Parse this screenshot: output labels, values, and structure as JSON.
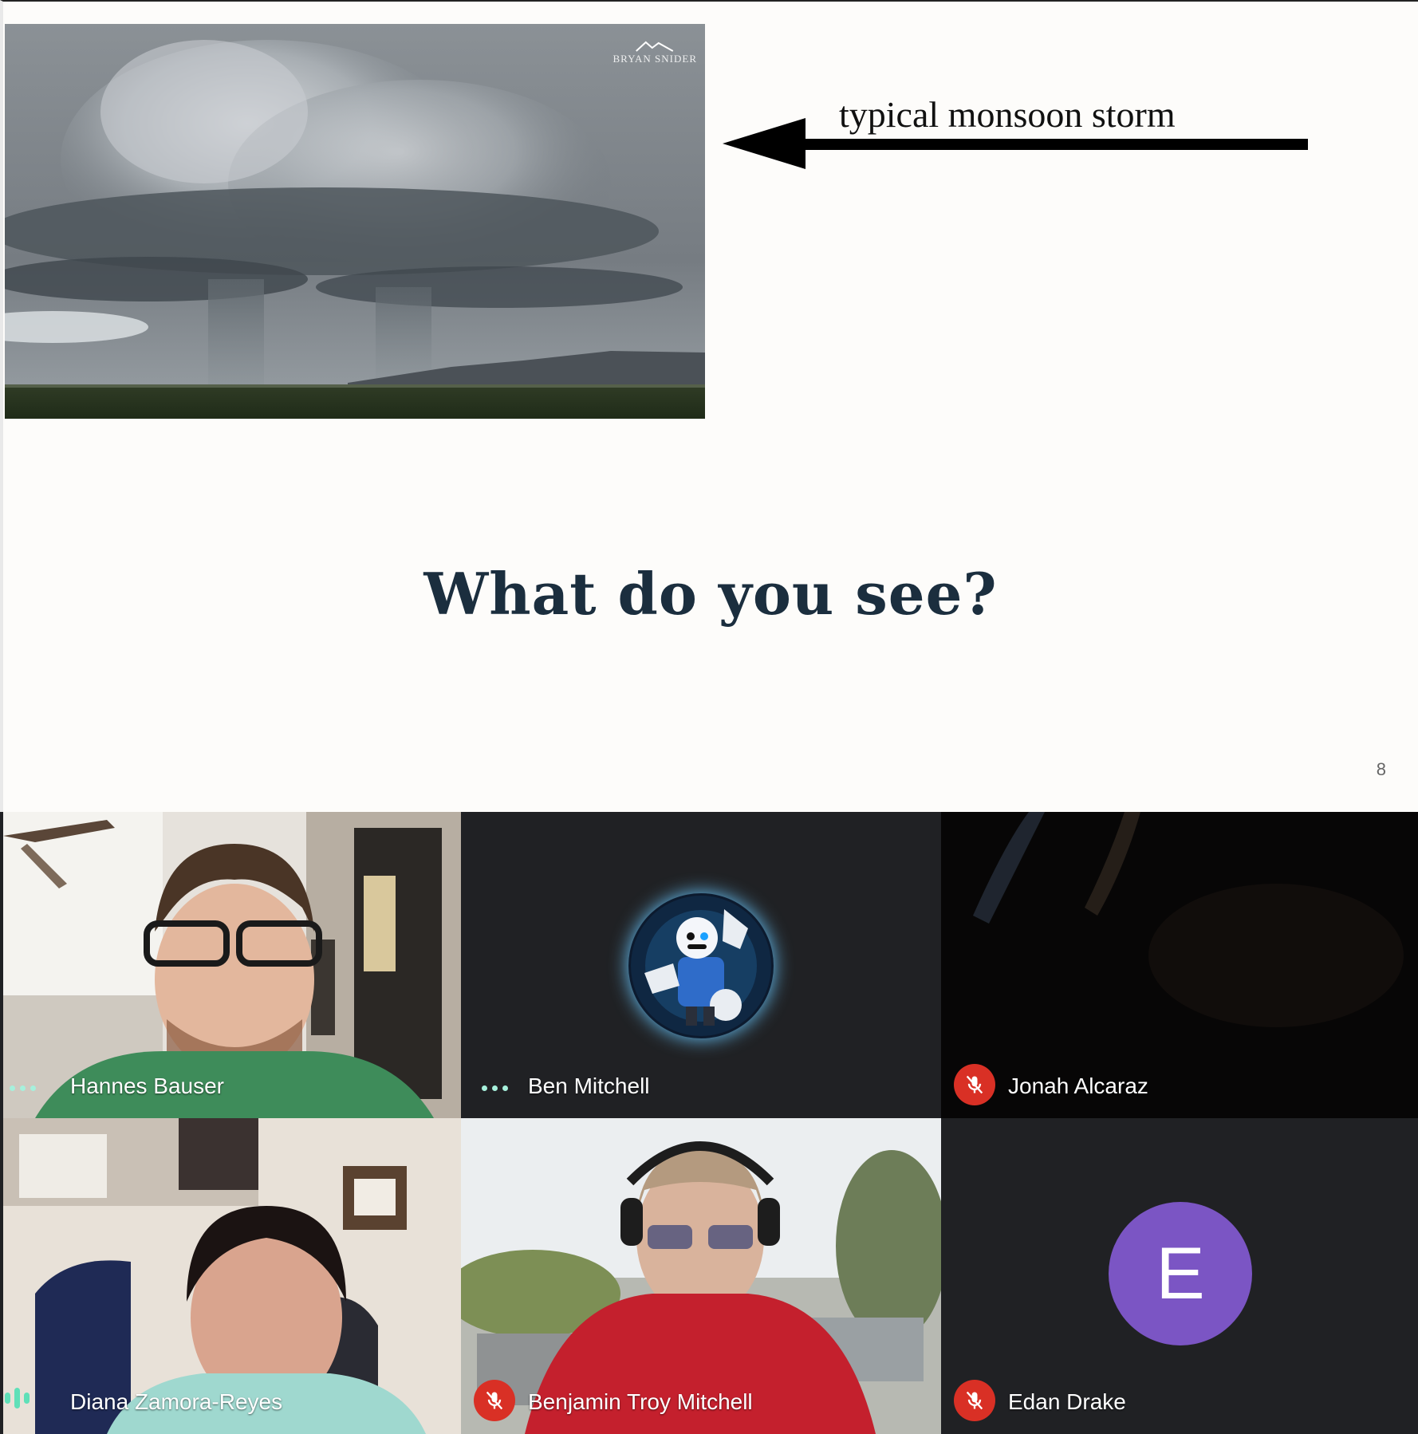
{
  "slide": {
    "caption": "typical monsoon storm",
    "question": "What do you see?",
    "page_number": "8",
    "watermark": "BRYAN SNIDER"
  },
  "participants": [
    {
      "name": "Hannes Bauser",
      "status": "more-options-icon"
    },
    {
      "name": "Ben Mitchell",
      "status": "more-options-icon"
    },
    {
      "name": "Jonah Alcaraz",
      "status": "mic-off-icon"
    },
    {
      "name": "Diana Zamora-Reyes",
      "status": "speaking-icon"
    },
    {
      "name": "Benjamin Troy Mitchell",
      "status": "mic-off-icon"
    },
    {
      "name": "Edan Drake",
      "status": "mic-off-icon",
      "avatar_letter": "E"
    }
  ],
  "colors": {
    "question_text": "#1b2e3e",
    "tile_background": "#202124",
    "mic_off": "#d93025",
    "avatar_purple": "#7b55c4",
    "speaking_indicator": "#5fe0b8"
  }
}
